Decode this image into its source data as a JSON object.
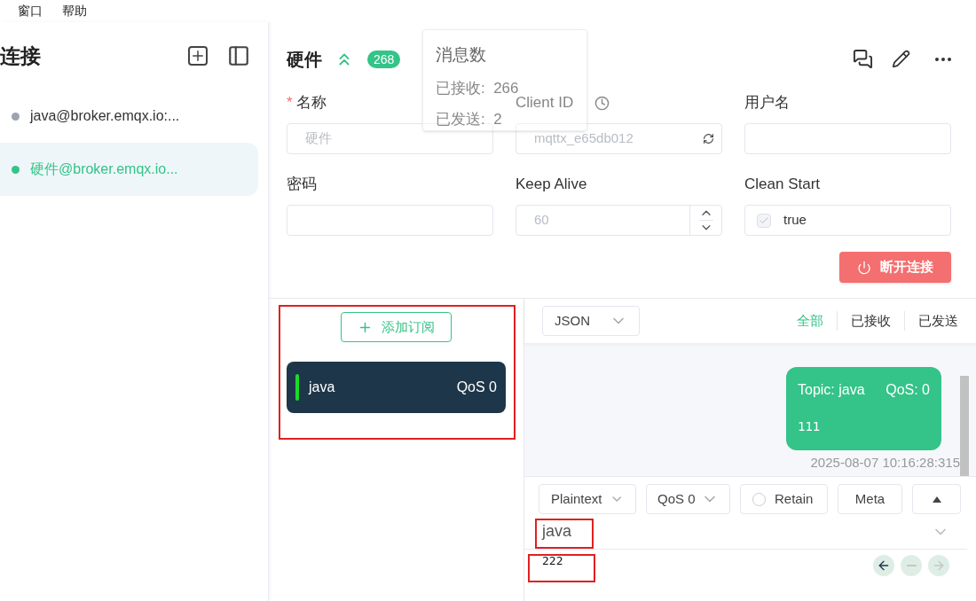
{
  "menu": [
    "窗口",
    "帮助"
  ],
  "sidebar": {
    "title": "连接",
    "items": [
      {
        "label": "java@broker.emqx.io:...",
        "connected": false,
        "selected": false
      },
      {
        "label": "硬件@broker.emqx.io...",
        "connected": true,
        "selected": true
      }
    ]
  },
  "header": {
    "title": "硬件",
    "badge": "268"
  },
  "tooltip": {
    "title": "消息数",
    "lines": [
      "已接收:  266",
      "已发送:  2"
    ]
  },
  "form": [
    {
      "label": "名称",
      "required_mark": "*",
      "kind": "text",
      "value": "硬件",
      "disabled": true
    },
    {
      "label": "Client ID",
      "kind": "clientid",
      "value": "mqttx_e65db012",
      "disabled": true
    },
    {
      "label": "用户名",
      "kind": "text"
    },
    {
      "label": "密码",
      "kind": "text"
    },
    {
      "label": "Keep Alive",
      "kind": "number",
      "value": "60",
      "disabled": true
    },
    {
      "label": "Clean Start",
      "kind": "checkbox",
      "value": "true",
      "checked": true,
      "disabled": true
    }
  ],
  "disconnect_button": "断开连接",
  "add_subscription": "添加订阅",
  "subscriptions": [
    {
      "topic": "java",
      "qos": "QoS 0",
      "color": "#1adb2a"
    }
  ],
  "format_select": "JSON",
  "filters": [
    {
      "label": "全部",
      "selected": true
    },
    {
      "label": "已接收",
      "selected": false
    },
    {
      "label": "已发送",
      "selected": false
    }
  ],
  "messages": [
    {
      "kind": "sent",
      "topic": "Topic: java",
      "qos": "QoS: 0",
      "payload": "111",
      "time": "2025-08-07 10:16:28:315"
    }
  ],
  "compose": {
    "format": "Plaintext",
    "qos": "QoS 0",
    "retain": {
      "label": "Retain",
      "checked": false
    },
    "meta": "Meta",
    "topic": "java",
    "payload": "222"
  }
}
